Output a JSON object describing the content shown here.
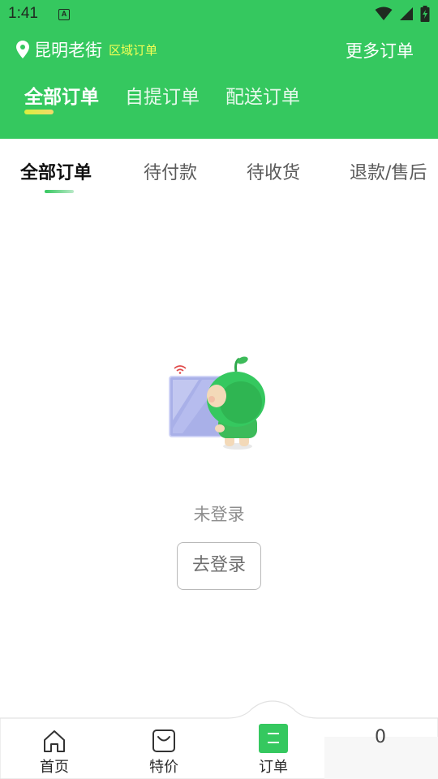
{
  "status_bar": {
    "time": "1:41",
    "notification_badge": "A",
    "icons": [
      "wifi-icon",
      "signal-icon",
      "battery-charging-icon"
    ]
  },
  "header": {
    "city": "昆明老街",
    "region_label": "区域订单",
    "more_orders": "更多订单",
    "tabs": [
      {
        "label": "全部订单",
        "active": true
      },
      {
        "label": "自提订单",
        "active": false
      },
      {
        "label": "配送订单",
        "active": false
      }
    ]
  },
  "sub_tabs": [
    {
      "label": "全部订单",
      "active": true
    },
    {
      "label": "待付款",
      "active": false
    },
    {
      "label": "待收货",
      "active": false
    },
    {
      "label": "退款/售后",
      "active": false
    }
  ],
  "empty_state": {
    "message": "未登录",
    "login_button": "去登录"
  },
  "bottom_nav": {
    "items": [
      {
        "label": "首页",
        "icon": "home-icon",
        "active": false
      },
      {
        "label": "特价",
        "icon": "shopping-bag-icon",
        "active": false
      },
      {
        "label": "订单",
        "icon": "order-list-icon",
        "active": true
      }
    ],
    "badge_text": "0"
  },
  "colors": {
    "brand_green": "#35c85f",
    "region_yellow": "#f4ff55"
  }
}
